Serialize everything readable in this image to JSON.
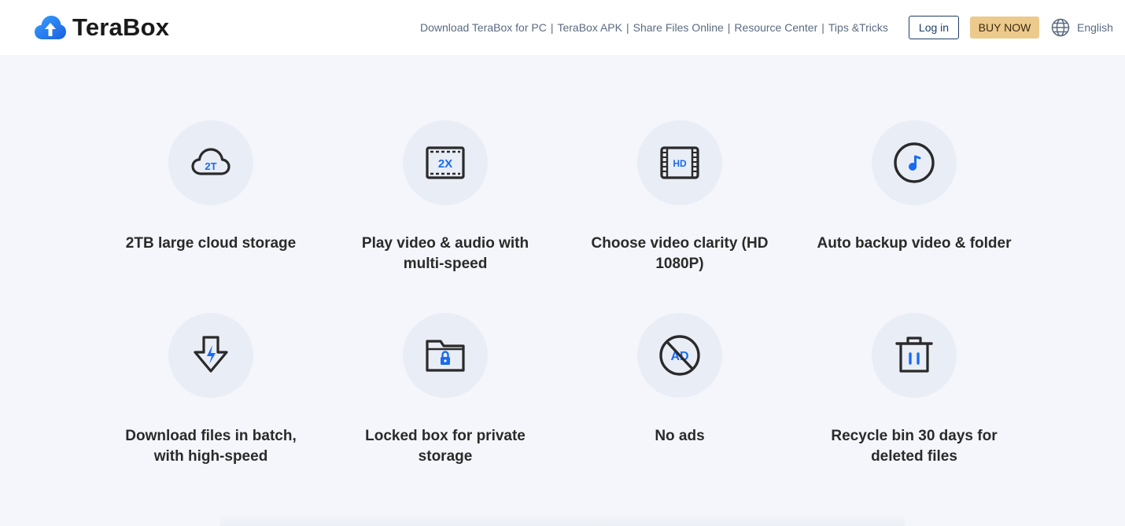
{
  "brand": {
    "name": "TeraBox"
  },
  "colors": {
    "accent": "#1a6bf0",
    "dark": "#2a2a2a",
    "buy_bg": "#ecca8c"
  },
  "nav": {
    "links": [
      "Download TeraBox for PC",
      "TeraBox APK",
      "Share Files Online",
      "Resource Center",
      "Tips &Tricks"
    ],
    "separator": "|"
  },
  "header": {
    "login_label": "Log in",
    "buy_label": "BUY NOW",
    "language": "English"
  },
  "features": [
    {
      "icon": "cloud-2t-icon",
      "title": "2TB large cloud storage",
      "badge": "2T"
    },
    {
      "icon": "speed-2x-icon",
      "title": "Play video & audio with multi-speed",
      "badge": "2X"
    },
    {
      "icon": "hd-video-icon",
      "title": "Choose video clarity (HD 1080P)",
      "badge": "HD"
    },
    {
      "icon": "music-backup-icon",
      "title": "Auto backup video & folder"
    },
    {
      "icon": "download-bolt-icon",
      "title": "Download files in batch, with high-speed"
    },
    {
      "icon": "locked-folder-icon",
      "title": "Locked box for private storage"
    },
    {
      "icon": "no-ads-icon",
      "title": "No ads",
      "badge": "AD"
    },
    {
      "icon": "trash-icon",
      "title": "Recycle bin 30 days for deleted files"
    }
  ]
}
